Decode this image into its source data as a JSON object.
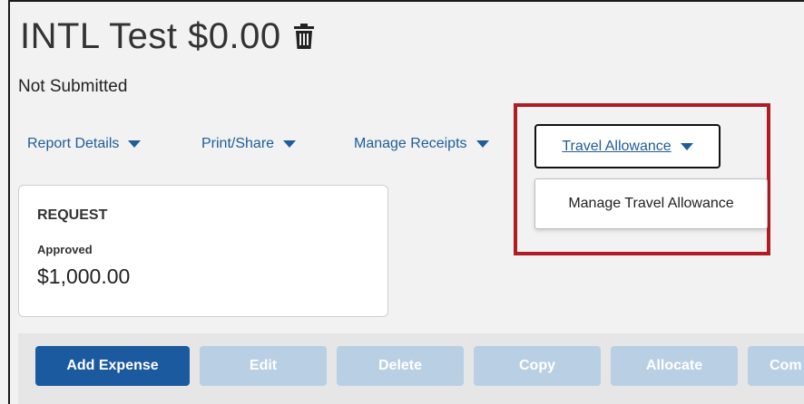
{
  "report": {
    "title": "INTL Test $0.00",
    "status": "Not Submitted"
  },
  "menu": {
    "items": [
      {
        "label": "Report Details"
      },
      {
        "label": "Print/Share"
      },
      {
        "label": "Manage Receipts"
      },
      {
        "label": "Travel Allowance"
      }
    ],
    "dropdown_item": "Manage Travel Allowance"
  },
  "request_card": {
    "heading": "REQUEST",
    "status_label": "Approved",
    "amount": "$1,000.00"
  },
  "toolbar": {
    "buttons": [
      {
        "label": "Add Expense",
        "enabled": true
      },
      {
        "label": "Edit",
        "enabled": false
      },
      {
        "label": "Delete",
        "enabled": false
      },
      {
        "label": "Copy",
        "enabled": false
      },
      {
        "label": "Allocate",
        "enabled": false
      },
      {
        "label": "Com",
        "enabled": false
      }
    ]
  },
  "colors": {
    "link": "#1f5c99",
    "primary_button": "#1c5aa0",
    "disabled_button": "#b9cfe4",
    "highlight_border": "#b01c24"
  },
  "icons": {
    "title_icon": "trash-icon",
    "menu_caret": "caret-down-icon"
  }
}
